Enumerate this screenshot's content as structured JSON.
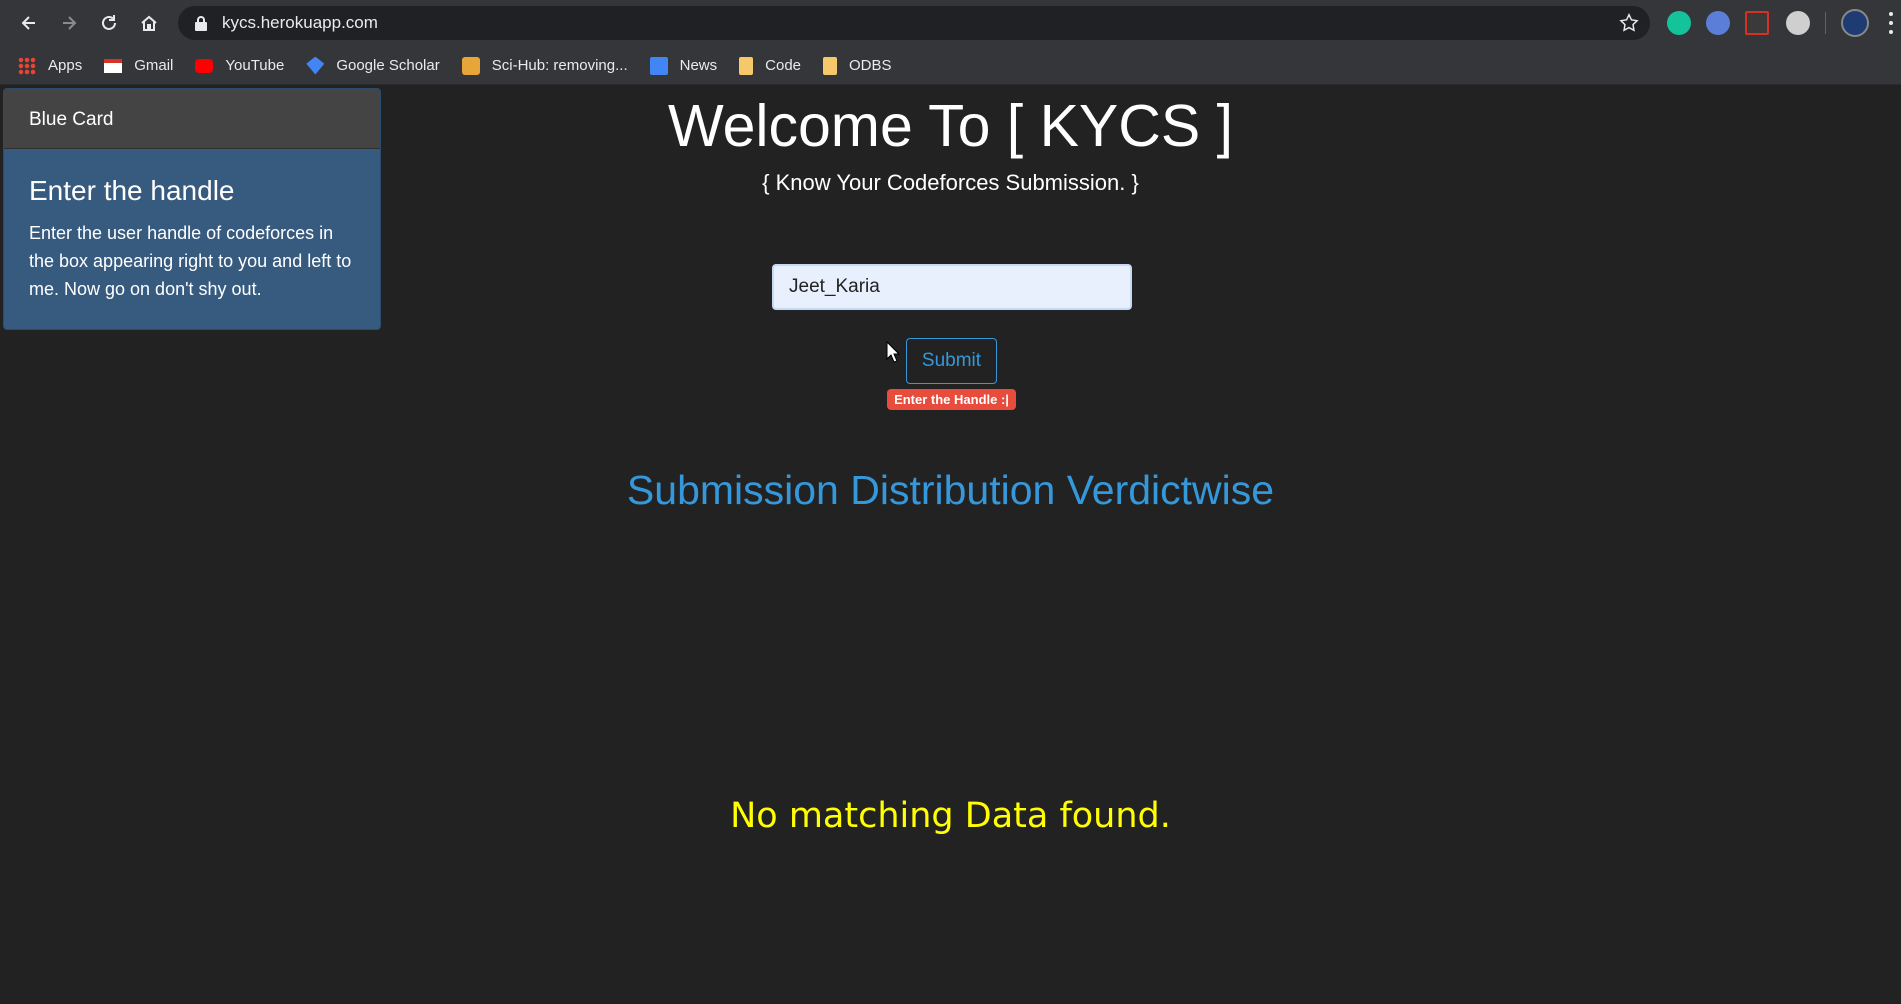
{
  "browser": {
    "url": "kycs.herokuapp.com",
    "bookmarks": [
      {
        "label": "Apps",
        "icon": "apps-grid-icon"
      },
      {
        "label": "Gmail",
        "icon": "gmail-icon"
      },
      {
        "label": "YouTube",
        "icon": "youtube-icon"
      },
      {
        "label": "Google Scholar",
        "icon": "scholar-icon"
      },
      {
        "label": "Sci-Hub: removing...",
        "icon": "scihub-icon"
      },
      {
        "label": "News",
        "icon": "news-icon"
      },
      {
        "label": "Code",
        "icon": "folder-icon"
      },
      {
        "label": "ODBS",
        "icon": "folder-icon"
      }
    ]
  },
  "sidebar_card": {
    "header": "Blue Card",
    "title": "Enter the handle",
    "text": "Enter the user handle of codeforces in the box appearing right to you and left to me. Now go on don't shy out."
  },
  "main": {
    "heading": "Welcome To [ KYCS ]",
    "subheading": "{ Know Your Codeforces Submission. }",
    "handle_value": "Jeet_Karia",
    "submit_label": "Submit",
    "badge": "Enter the Handle :|",
    "section_title": "Submission Distribution Verdictwise",
    "no_data": "No matching Data found."
  },
  "colors": {
    "page_bg": "#222222",
    "card_bg": "#375a7f",
    "accent": "#3498db",
    "badge": "#e74c3c",
    "no_data": "#ffff00"
  }
}
